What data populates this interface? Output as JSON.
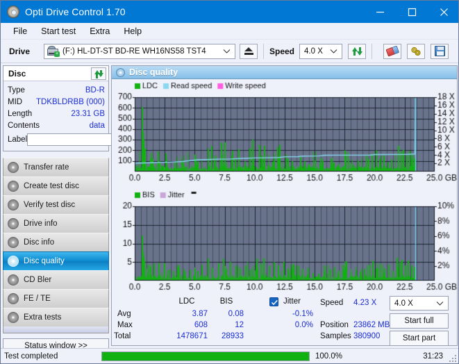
{
  "window": {
    "title": "Opti Drive Control 1.70",
    "icon": "disc-icon",
    "minimize": "minimize-icon",
    "maximize": "maximize-icon",
    "close": "close-icon",
    "accent": "#0078d4"
  },
  "menubar": {
    "items": [
      {
        "label": "File"
      },
      {
        "label": "Start test"
      },
      {
        "label": "Extra"
      },
      {
        "label": "Help"
      }
    ]
  },
  "toolbar": {
    "drive_label": "Drive",
    "drive_value": "(F:)  HL-DT-ST BD-RE  WH16NS58 TST4",
    "eject": "eject-icon",
    "speed_label": "Speed",
    "speed_value": "4.0 X",
    "refresh": "refresh-icon",
    "erase": "eraser-icon",
    "tools": "gear-icon",
    "save": "save-icon"
  },
  "disc_panel": {
    "title": "Disc",
    "refresh_icon": "refresh-icon",
    "rows": [
      {
        "key": "Type",
        "value": "BD-R"
      },
      {
        "key": "MID",
        "value": "TDKBLDRBB (000)"
      },
      {
        "key": "Length",
        "value": "23.31 GB"
      },
      {
        "key": "Contents",
        "value": "data"
      }
    ],
    "label_key": "Label",
    "label_value": "",
    "label_button_icon": "cd-icon"
  },
  "sidebar": {
    "items": [
      {
        "label": "Transfer rate",
        "selected": false
      },
      {
        "label": "Create test disc",
        "selected": false
      },
      {
        "label": "Verify test disc",
        "selected": false
      },
      {
        "label": "Drive info",
        "selected": false
      },
      {
        "label": "Disc info",
        "selected": false
      },
      {
        "label": "Disc quality",
        "selected": true
      },
      {
        "label": "CD Bler",
        "selected": false
      },
      {
        "label": "FE / TE",
        "selected": false
      },
      {
        "label": "Extra tests",
        "selected": false
      }
    ],
    "status_window": "Status window >>"
  },
  "main": {
    "header_title": "Disc quality",
    "header_icon": "disc-quality-icon"
  },
  "stats": {
    "col_ldc": "LDC",
    "col_bis": "BIS",
    "jitter_label": "Jitter",
    "jitter_checked": true,
    "rows": [
      {
        "label": "Avg",
        "ldc": "3.87",
        "bis": "0.08",
        "jitter": "-0.1%"
      },
      {
        "label": "Max",
        "ldc": "608",
        "bis": "12",
        "jitter": "0.0%"
      },
      {
        "label": "Total",
        "ldc": "1478671",
        "bis": "28933",
        "jitter": ""
      }
    ],
    "speed_label": "Speed",
    "speed_value": "4.23 X",
    "position_label": "Position",
    "position_value": "23862 MB",
    "samples_label": "Samples",
    "samples_value": "380900",
    "speed_select": "4.0 X",
    "start_full": "Start full",
    "start_part": "Start part"
  },
  "statusbar": {
    "text": "Test completed",
    "progress_pct": "100.0%",
    "progress_value": 100,
    "elapsed": "31:23"
  },
  "chart_data": [
    {
      "type": "area",
      "id": "ldc-chart",
      "title": "",
      "xlabel": "GB",
      "ylabel": "",
      "xlim": [
        0,
        25.0
      ],
      "xticks": [
        0.0,
        2.5,
        5.0,
        7.5,
        10.0,
        12.5,
        15.0,
        17.5,
        20.0,
        22.5,
        25.0
      ],
      "xticklabels": [
        "0.0",
        "2.5",
        "5.0",
        "7.5",
        "10.0",
        "12.5",
        "15.0",
        "17.5",
        "20.0",
        "22.5",
        "25.0 GB"
      ],
      "ylim": [
        0,
        700
      ],
      "yticks": [
        100,
        200,
        300,
        400,
        500,
        600,
        700
      ],
      "yticklabels": [
        "100",
        "200",
        "300",
        "400",
        "500",
        "600",
        "700"
      ],
      "y2lim": [
        0,
        18
      ],
      "y2ticks": [
        2,
        4,
        6,
        8,
        10,
        12,
        14,
        16,
        18
      ],
      "y2ticklabels": [
        "2 X",
        "4 X",
        "6 X",
        "8 X",
        "10 X",
        "12 X",
        "14 X",
        "16 X",
        "18 X"
      ],
      "grid": true,
      "plot_bg": "#69748c",
      "legend": [
        {
          "name": "LDC",
          "color": "#12b112"
        },
        {
          "name": "Read speed",
          "color": "#87d9f2"
        },
        {
          "name": "Write speed",
          "color": "#ff5ce0"
        }
      ],
      "data_end_x": 23.4,
      "series": [
        {
          "name": "LDC",
          "type": "bar",
          "color": "#12b112",
          "seed": 1701,
          "baseline": 30,
          "spikes": [
            [
              0.55,
              608
            ],
            [
              0.62,
              372
            ],
            [
              0.68,
              300
            ],
            [
              0.72,
              262
            ],
            [
              0.8,
              218
            ],
            [
              1.35,
              176
            ],
            [
              1.45,
              120
            ],
            [
              1.9,
              190
            ],
            [
              2.05,
              95
            ],
            [
              2.55,
              172
            ],
            [
              2.62,
              110
            ],
            [
              3.3,
              90
            ],
            [
              3.95,
              88
            ],
            [
              4.95,
              160
            ],
            [
              5.05,
              128
            ],
            [
              5.2,
              96
            ],
            [
              6.1,
              216
            ],
            [
              6.35,
              242
            ],
            [
              6.6,
              100
            ],
            [
              7.15,
              272
            ],
            [
              7.25,
              160
            ],
            [
              7.45,
              276
            ],
            [
              8.1,
              196
            ],
            [
              8.35,
              118
            ],
            [
              8.6,
              210
            ],
            [
              9.15,
              96
            ],
            [
              9.55,
              220
            ],
            [
              9.8,
              300
            ],
            [
              10.35,
              252
            ],
            [
              10.55,
              150
            ],
            [
              10.75,
              242
            ],
            [
              11.45,
              92
            ],
            [
              11.85,
              230
            ],
            [
              12.05,
              254
            ],
            [
              12.55,
              160
            ],
            [
              12.75,
              120
            ],
            [
              13.1,
              100
            ],
            [
              13.8,
              140
            ],
            [
              14.1,
              96
            ],
            [
              14.45,
              72
            ],
            [
              15.45,
              128
            ],
            [
              15.6,
              98
            ],
            [
              16.3,
              120
            ],
            [
              16.55,
              84
            ],
            [
              16.95,
              74
            ],
            [
              17.45,
              200
            ],
            [
              17.55,
              172
            ],
            [
              17.75,
              120
            ],
            [
              18.2,
              62
            ],
            [
              18.55,
              78
            ],
            [
              19.25,
              160
            ],
            [
              19.45,
              118
            ],
            [
              19.75,
              168
            ],
            [
              20.1,
              200
            ],
            [
              20.35,
              118
            ],
            [
              20.7,
              150
            ],
            [
              21.05,
              90
            ],
            [
              21.35,
              112
            ],
            [
              21.95,
              244
            ],
            [
              22.15,
              188
            ],
            [
              22.35,
              206
            ],
            [
              22.65,
              150
            ],
            [
              22.85,
              196
            ],
            [
              23.1,
              166
            ],
            [
              23.3,
              120
            ]
          ]
        },
        {
          "name": "Read speed",
          "type": "line",
          "axis": "y2",
          "color": "#87d9f2",
          "points": [
            [
              0.0,
              2.0
            ],
            [
              0.3,
              2.05
            ],
            [
              1.0,
              2.1
            ],
            [
              2.0,
              2.2
            ],
            [
              3.0,
              2.3
            ],
            [
              4.0,
              2.45
            ],
            [
              4.8,
              2.7
            ],
            [
              5.2,
              2.85
            ],
            [
              6.0,
              2.9
            ],
            [
              7.0,
              3.0
            ],
            [
              8.0,
              3.05
            ],
            [
              9.0,
              3.2
            ],
            [
              10.0,
              3.3
            ],
            [
              11.0,
              3.35
            ],
            [
              12.0,
              3.4
            ],
            [
              12.6,
              3.6
            ],
            [
              13.6,
              3.62
            ],
            [
              14.0,
              3.75
            ],
            [
              15.4,
              3.8
            ],
            [
              15.8,
              3.95
            ],
            [
              17.0,
              3.98
            ],
            [
              19.6,
              4.0
            ],
            [
              20.0,
              4.12
            ],
            [
              22.6,
              4.15
            ],
            [
              23.0,
              4.2
            ],
            [
              23.35,
              4.22
            ],
            [
              23.4,
              18.0
            ]
          ]
        }
      ]
    },
    {
      "type": "area",
      "id": "bis-chart",
      "title": "",
      "xlabel": "GB",
      "xlim": [
        0,
        25.0
      ],
      "xticks": [
        0.0,
        2.5,
        5.0,
        7.5,
        10.0,
        12.5,
        15.0,
        17.5,
        20.0,
        22.5,
        25.0
      ],
      "xticklabels": [
        "0.0",
        "2.5",
        "5.0",
        "7.5",
        "10.0",
        "12.5",
        "15.0",
        "17.5",
        "20.0",
        "22.5",
        "25.0 GB"
      ],
      "ylim": [
        0,
        20
      ],
      "yticks": [
        5,
        10,
        15,
        20
      ],
      "yticklabels": [
        "5",
        "10",
        "15",
        "20"
      ],
      "y2lim": [
        0,
        10
      ],
      "y2ticks": [
        2,
        4,
        6,
        8,
        10
      ],
      "y2ticklabels": [
        "2%",
        "4%",
        "6%",
        "8%",
        "10%"
      ],
      "grid": true,
      "plot_bg": "#69748c",
      "legend": [
        {
          "name": "BIS",
          "color": "#12b112"
        },
        {
          "name": "Jitter",
          "color": "#c9a6d6"
        }
      ],
      "data_end_x": 23.4,
      "series": [
        {
          "name": "BIS",
          "type": "bar",
          "color": "#12b112",
          "seed": 99,
          "baseline": 0.8,
          "spikes": [
            [
              0.55,
              12.1
            ],
            [
              0.62,
              7.6
            ],
            [
              0.68,
              6.3
            ],
            [
              0.75,
              5.4
            ],
            [
              1.1,
              4.4
            ],
            [
              1.3,
              3.9
            ],
            [
              1.55,
              4.6
            ],
            [
              1.95,
              4.8
            ],
            [
              2.45,
              4.7
            ],
            [
              2.85,
              3.0
            ],
            [
              3.2,
              2.6
            ],
            [
              3.55,
              4.0
            ],
            [
              4.1,
              2.6
            ],
            [
              4.55,
              2.9
            ],
            [
              4.95,
              3.2
            ],
            [
              5.2,
              2.6
            ],
            [
              5.55,
              4.2
            ],
            [
              6.1,
              5.9
            ],
            [
              6.45,
              3.5
            ],
            [
              6.95,
              4.7
            ],
            [
              7.35,
              5.9
            ],
            [
              7.6,
              3.1
            ],
            [
              7.9,
              5.0
            ],
            [
              8.4,
              4.0
            ],
            [
              8.75,
              3.3
            ],
            [
              9.2,
              4.0
            ],
            [
              9.55,
              2.9
            ],
            [
              10.1,
              5.9
            ],
            [
              10.45,
              4.6
            ],
            [
              10.7,
              6.0
            ],
            [
              11.15,
              4.0
            ],
            [
              11.6,
              5.0
            ],
            [
              11.95,
              4.1
            ],
            [
              12.4,
              5.1
            ],
            [
              12.75,
              3.3
            ],
            [
              13.2,
              4.4
            ],
            [
              13.6,
              4.0
            ],
            [
              13.95,
              3.2
            ],
            [
              14.4,
              3.5
            ],
            [
              14.8,
              2.0
            ],
            [
              15.3,
              1.8
            ],
            [
              15.8,
              2.5
            ],
            [
              16.25,
              3.0
            ],
            [
              16.6,
              3.6
            ],
            [
              16.95,
              2.7
            ],
            [
              17.3,
              4.2
            ],
            [
              17.6,
              5.1
            ],
            [
              18.0,
              2.2
            ],
            [
              18.4,
              2.8
            ],
            [
              18.75,
              2.5
            ],
            [
              19.1,
              3.1
            ],
            [
              19.5,
              4.2
            ],
            [
              19.8,
              5.4
            ],
            [
              20.1,
              3.3
            ],
            [
              20.45,
              4.6
            ],
            [
              20.8,
              3.3
            ],
            [
              21.1,
              4.3
            ],
            [
              21.45,
              2.6
            ],
            [
              21.8,
              6.2
            ],
            [
              22.05,
              5.0
            ],
            [
              22.25,
              5.6
            ],
            [
              22.5,
              4.1
            ],
            [
              22.75,
              5.4
            ],
            [
              23.05,
              4.0
            ],
            [
              23.25,
              3.6
            ]
          ]
        },
        {
          "name": "Jitter",
          "type": "line",
          "axis": "y2",
          "color": "#c9a6d6",
          "points": []
        }
      ]
    }
  ]
}
